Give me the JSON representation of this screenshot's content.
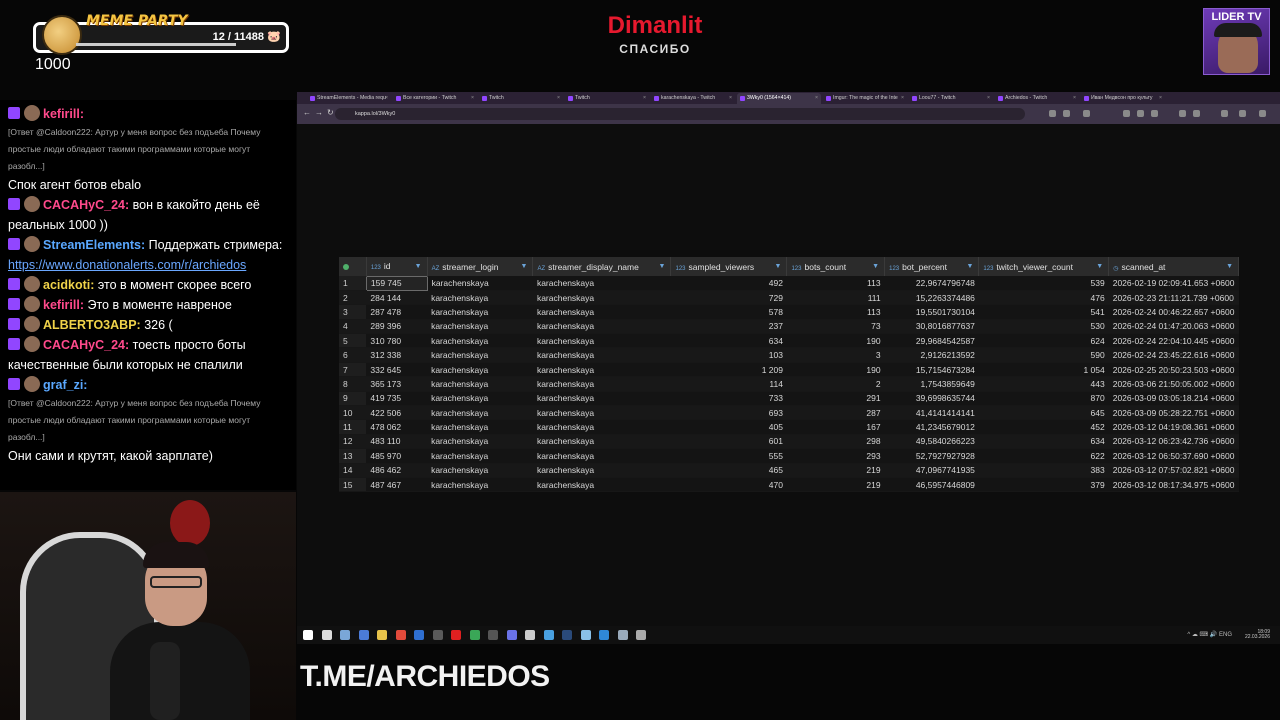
{
  "overlay": {
    "meme_title": "MEME PARTY",
    "meme_count": "12 / 11488",
    "meme_pig": "🐷",
    "goal": "1000",
    "donor_name": "Dimanlit",
    "donor_message": "СПАСИБО",
    "channel_badge": "LIDER TV",
    "footer_link": "T.ME/ARCHIEDOS"
  },
  "chat": [
    {
      "user": "kefirill:",
      "user_color": "pink",
      "text": "",
      "reply": ""
    },
    {
      "user": "",
      "user_color": "",
      "text": "",
      "reply": "[Ответ @Caldoon222: Артур у меня вопрос без подъеба Почему простые люди обладают такими программами которые могут разобл...]"
    },
    {
      "user": "",
      "user_color": "",
      "text": "Спок агент ботов ebalo",
      "reply": ""
    },
    {
      "user": "CACAHyC_24:",
      "user_color": "pink",
      "text": "вон в какойто день её реальных 1000 ))",
      "reply": ""
    },
    {
      "user": "StreamElements:",
      "user_color": "blue",
      "text": "Поддержать стримера:",
      "link": "https://www.donationalerts.com/r/archiedos",
      "reply": ""
    },
    {
      "user": "acidkoti:",
      "user_color": "yellow",
      "text": "это в момент скорее всего",
      "reply": ""
    },
    {
      "user": "kefirill:",
      "user_color": "pink",
      "text": "Это в моменте навреное",
      "reply": ""
    },
    {
      "user": "ALBERTO3ABP:",
      "user_color": "yellow",
      "text": "326 (",
      "reply": ""
    },
    {
      "user": "CACAHyC_24:",
      "user_color": "pink",
      "text": "тоесть просто боты качественные были которых не спалили",
      "reply": ""
    },
    {
      "user": "graf_zi:",
      "user_color": "blue",
      "text": "",
      "reply": ""
    },
    {
      "user": "",
      "user_color": "",
      "text": "",
      "reply": "[Ответ @Caldoon222: Артур у меня вопрос без подъеба Почему простые люди обладают такими программами которые могут разобл...]"
    },
    {
      "user": "",
      "user_color": "",
      "text": "Они сами и крутят, какой зарплате)",
      "reply": ""
    }
  ],
  "browser": {
    "tabs": [
      {
        "label": "StreamElements - Media requ"
      },
      {
        "label": "Все категории - Twitch"
      },
      {
        "label": "Twitch"
      },
      {
        "label": "Twitch"
      },
      {
        "label": "karachenskaya - Twitch"
      },
      {
        "label": "3Wky0 (1564×414)"
      },
      {
        "label": "Imgur: The magic of the Inte"
      },
      {
        "label": "Loou77 - Twitch"
      },
      {
        "label": "Archiedos - Twitch"
      },
      {
        "label": "Иван Медвсон про культу"
      }
    ],
    "active_tab": 5,
    "url": "kappa.lol/3Wky0"
  },
  "table": {
    "columns": [
      {
        "type": "123",
        "name": "id"
      },
      {
        "type": "AZ",
        "name": "streamer_login"
      },
      {
        "type": "AZ",
        "name": "streamer_display_name"
      },
      {
        "type": "123",
        "name": "sampled_viewers"
      },
      {
        "type": "123",
        "name": "bots_count"
      },
      {
        "type": "123",
        "name": "bot_percent"
      },
      {
        "type": "123",
        "name": "twitch_viewer_count"
      },
      {
        "type": "◷",
        "name": "scanned_at"
      }
    ],
    "rows": [
      [
        "1",
        "159 745",
        "karachenskaya",
        "karachenskaya",
        "492",
        "113",
        "22,9674796748",
        "539",
        "2026-02-19 02:09:41.653 +0600"
      ],
      [
        "2",
        "284 144",
        "karachenskaya",
        "karachenskaya",
        "729",
        "111",
        "15,2263374486",
        "476",
        "2026-02-23 21:11:21.739 +0600"
      ],
      [
        "3",
        "287 478",
        "karachenskaya",
        "karachenskaya",
        "578",
        "113",
        "19,5501730104",
        "541",
        "2026-02-24 00:46:22.657 +0600"
      ],
      [
        "4",
        "289 396",
        "karachenskaya",
        "karachenskaya",
        "237",
        "73",
        "30,8016877637",
        "530",
        "2026-02-24 01:47:20.063 +0600"
      ],
      [
        "5",
        "310 780",
        "karachenskaya",
        "karachenskaya",
        "634",
        "190",
        "29,9684542587",
        "624",
        "2026-02-24 22:04:10.445 +0600"
      ],
      [
        "6",
        "312 338",
        "karachenskaya",
        "karachenskaya",
        "103",
        "3",
        "2,9126213592",
        "590",
        "2026-02-24 23:45:22.616 +0600"
      ],
      [
        "7",
        "332 645",
        "karachenskaya",
        "karachenskaya",
        "1 209",
        "190",
        "15,7154673284",
        "1 054",
        "2026-02-25 20:50:23.503 +0600"
      ],
      [
        "8",
        "365 173",
        "karachenskaya",
        "karachenskaya",
        "114",
        "2",
        "1,7543859649",
        "443",
        "2026-03-06 21:50:05.002 +0600"
      ],
      [
        "9",
        "419 735",
        "karachenskaya",
        "karachenskaya",
        "733",
        "291",
        "39,6998635744",
        "870",
        "2026-03-09 03:05:18.214 +0600"
      ],
      [
        "10",
        "422 506",
        "karachenskaya",
        "karachenskaya",
        "693",
        "287",
        "41,4141414141",
        "645",
        "2026-03-09 05:28:22.751 +0600"
      ],
      [
        "11",
        "478 062",
        "karachenskaya",
        "karachenskaya",
        "405",
        "167",
        "41,2345679012",
        "452",
        "2026-03-12 04:19:08.361 +0600"
      ],
      [
        "12",
        "483 110",
        "karachenskaya",
        "karachenskaya",
        "601",
        "298",
        "49,5840266223",
        "634",
        "2026-03-12 06:23:42.736 +0600"
      ],
      [
        "13",
        "485 970",
        "karachenskaya",
        "karachenskaya",
        "555",
        "293",
        "52,7927927928",
        "622",
        "2026-03-12 06:50:37.690 +0600"
      ],
      [
        "14",
        "486 462",
        "karachenskaya",
        "karachenskaya",
        "465",
        "219",
        "47,0967741935",
        "383",
        "2026-03-12 07:57:02.821 +0600"
      ],
      [
        "15",
        "487 467",
        "karachenskaya",
        "karachenskaya",
        "470",
        "219",
        "46,5957446809",
        "379",
        "2026-03-12 08:17:34.975 +0600"
      ]
    ]
  },
  "taskbar": {
    "icons": [
      "windows-start",
      "search",
      "taskview",
      "media-player",
      "file-explorer",
      "chrome",
      "word",
      "terminal",
      "youtube",
      "app",
      "obs",
      "discord",
      "settings",
      "app2",
      "steam",
      "app3",
      "browser",
      "app4",
      "app5"
    ],
    "lang": "ENG",
    "time": "18:09",
    "date": "22.03.2026"
  },
  "colors": {
    "accent": "#9146ff",
    "donor": "#e6192e",
    "grid_header": "#2b2b2b"
  }
}
